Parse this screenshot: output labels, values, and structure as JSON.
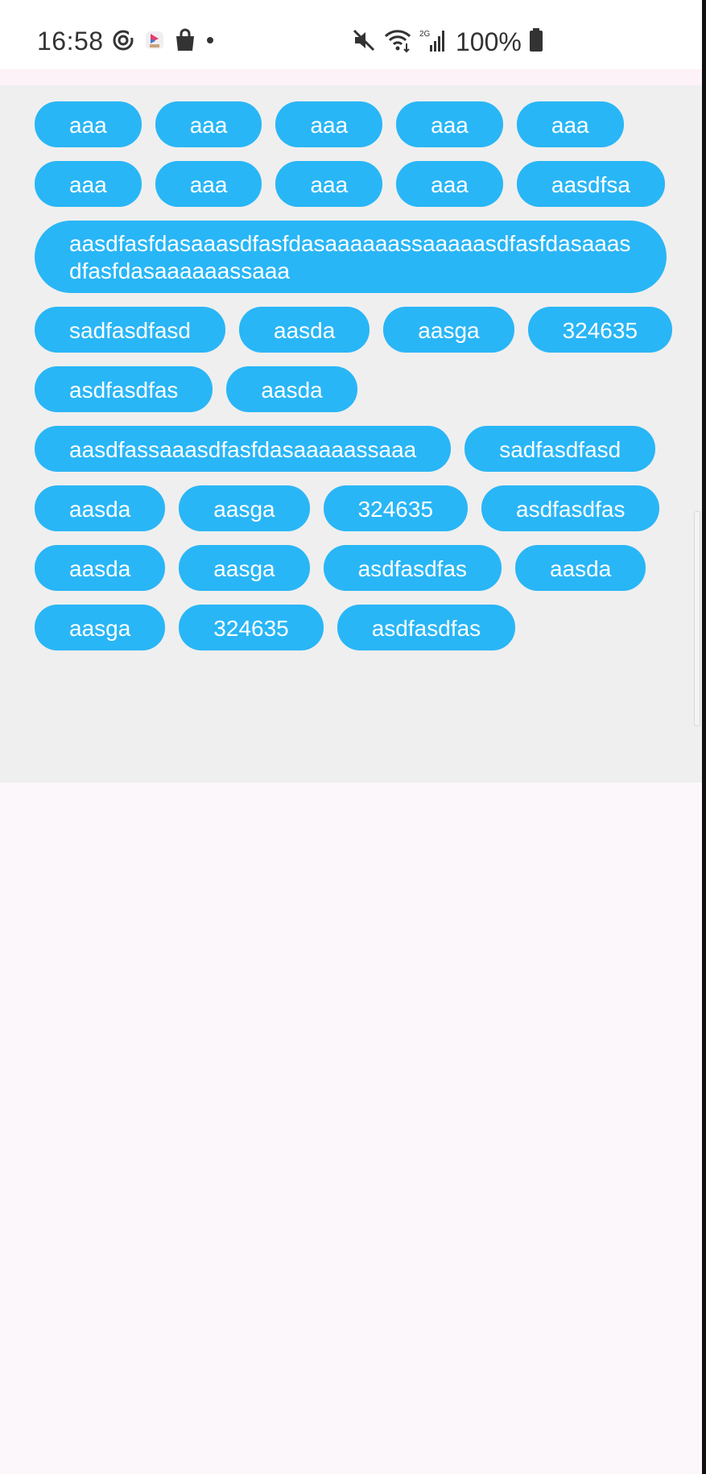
{
  "status_bar": {
    "time": "16:58",
    "battery_percent": "100%",
    "left_icons": [
      "sync-icon",
      "app-icon",
      "shopping-bag-icon",
      "dot-icon"
    ],
    "right_icons": [
      "mute-icon",
      "wifi-icon",
      "signal-2g-icon",
      "battery-icon"
    ]
  },
  "colors": {
    "chip_bg": "#29b6f6",
    "chip_text": "#ffffff",
    "chip_area_bg": "#efefef",
    "page_bg": "#fcf7fa"
  },
  "chips": [
    "aaa",
    "aaa",
    "aaa",
    "aaa",
    "aaa",
    "aaa",
    "aaa",
    "aaa",
    "aaa",
    "aasdfsa",
    "aasdfasfdasaaasdfasfdasaaaaaassaaaaasdfasfdasaaasdfasfdasaaaaaassaaa",
    "sadfasdfasd",
    "aasda",
    "aasga",
    "324635",
    "asdfasdfas",
    "aasda",
    "aasdfassaaasdfasfdasaaaaassaaa",
    "sadfasdfasd",
    "aasda",
    "aasga",
    "324635",
    "asdfasdfas",
    "aasda",
    "aasga",
    "asdfasdfas",
    "aasda",
    "aasga",
    "324635",
    "asdfasdfas"
  ]
}
